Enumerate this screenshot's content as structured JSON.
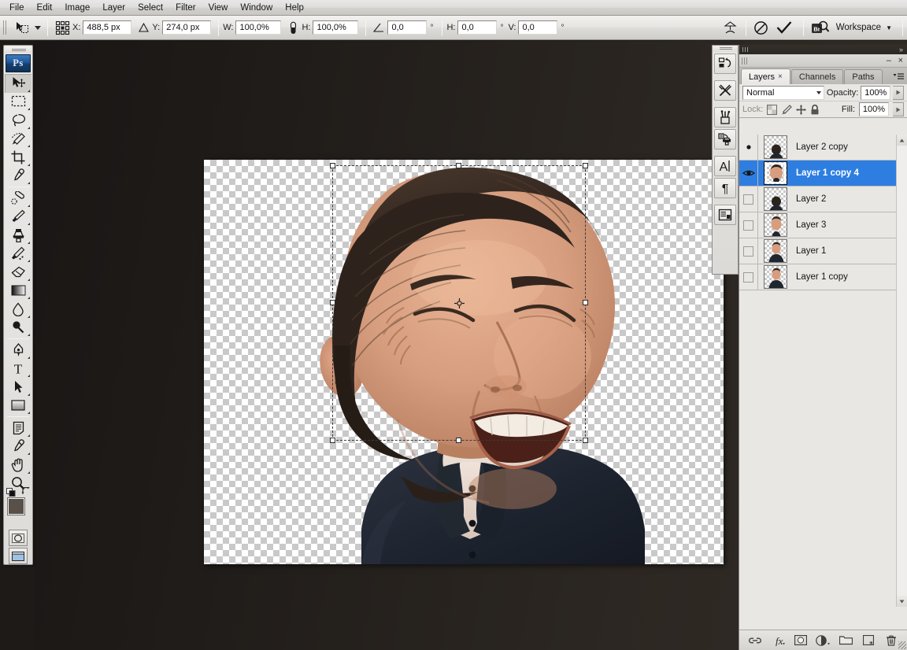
{
  "app": {
    "title": "Adobe Photoshop",
    "logo_text": "Ps"
  },
  "menubar": {
    "items": [
      {
        "label": "File"
      },
      {
        "label": "Edit"
      },
      {
        "label": "Image"
      },
      {
        "label": "Layer"
      },
      {
        "label": "Select"
      },
      {
        "label": "Filter"
      },
      {
        "label": "View"
      },
      {
        "label": "Window"
      },
      {
        "label": "Help"
      }
    ]
  },
  "options_bar": {
    "active_tool_icon": "move-tool-icon",
    "ref_point_icon": "reference-point-locator-icon",
    "x_label": "X:",
    "x_value": "488,5 px",
    "delta_icon": "delta-triangle-icon",
    "y_label": "Y:",
    "y_value": "274,0 px",
    "w_label": "W:",
    "w_value": "100,0%",
    "link_icon": "maintain-aspect-ratio-icon",
    "h_label": "H:",
    "h_value": "100,0%",
    "angle_icon": "rotate-angle-icon",
    "angle_value": "0,0",
    "angle_unit": "°",
    "skew_h_label": "H:",
    "skew_h_value": "0,0",
    "skew_h_unit": "°",
    "skew_v_label": "V:",
    "skew_v_value": "0,0",
    "skew_v_unit": "°",
    "warp_icon": "switch-to-warp-mode-icon",
    "cancel_icon": "cancel-transform-icon",
    "commit_icon": "commit-transform-icon",
    "bridge_icon": "go-to-bridge-icon",
    "workspace_label": "Workspace",
    "workspace_caret": "▼"
  },
  "toolbox": {
    "tools": [
      {
        "name": "move-tool",
        "selected": true,
        "has_flyout": true
      },
      {
        "name": "rectangular-marquee-tool",
        "has_flyout": true
      },
      {
        "name": "lasso-tool",
        "has_flyout": true
      },
      {
        "name": "quick-selection-tool",
        "has_flyout": true
      },
      {
        "name": "crop-tool",
        "has_flyout": true
      },
      {
        "name": "eyedropper-tool",
        "has_flyout": true
      },
      {
        "name": "spot-healing-brush-tool",
        "has_flyout": true,
        "group_start": true
      },
      {
        "name": "brush-tool",
        "has_flyout": true
      },
      {
        "name": "clone-stamp-tool",
        "has_flyout": true
      },
      {
        "name": "history-brush-tool",
        "has_flyout": true
      },
      {
        "name": "eraser-tool",
        "has_flyout": true
      },
      {
        "name": "gradient-tool",
        "has_flyout": true
      },
      {
        "name": "blur-tool",
        "has_flyout": true
      },
      {
        "name": "dodge-tool",
        "has_flyout": true
      },
      {
        "name": "pen-tool",
        "has_flyout": true,
        "group_start": true
      },
      {
        "name": "horizontal-type-tool",
        "has_flyout": true
      },
      {
        "name": "path-selection-tool",
        "has_flyout": true
      },
      {
        "name": "rectangle-shape-tool",
        "has_flyout": true
      },
      {
        "name": "notes-tool",
        "has_flyout": true,
        "group_start": true
      },
      {
        "name": "color-sampler-tool",
        "has_flyout": true
      },
      {
        "name": "hand-tool",
        "has_flyout": true
      },
      {
        "name": "zoom-tool",
        "has_flyout": false
      }
    ],
    "foreground_color": "#595049",
    "background_color": "#000000",
    "default_colors_icon": "default-foreground-background-icon",
    "swap_colors_icon": "swap-foreground-background-icon",
    "quickmask_icon": "edit-in-quick-mask-mode-icon",
    "screenmode_icon": "change-screen-mode-icon"
  },
  "icon_dock": {
    "buttons": [
      {
        "name": "history-panel-icon"
      },
      {
        "name": "tool-presets-panel-icon"
      },
      {
        "name": "brushes-panel-icon"
      },
      {
        "name": "clone-source-panel-icon"
      },
      {
        "name": "character-panel-icon",
        "glyph": "A"
      },
      {
        "name": "paragraph-panel-icon",
        "glyph": "¶"
      },
      {
        "name": "layer-comps-panel-icon"
      }
    ]
  },
  "canvas": {
    "transparency": "checkerboard",
    "transform_active": true,
    "reference_point_icon": "transform-reference-point-icon",
    "handles": [
      "top-left",
      "top-center",
      "top-right",
      "middle-left",
      "middle-right",
      "bottom-left",
      "bottom-center",
      "bottom-right"
    ],
    "artwork_description": "caricature portrait with enlarged head on dark jacket, transparent background"
  },
  "layers_panel": {
    "grip_icon": "panel-grip-icon",
    "expand_icon": "»",
    "minimize_label": "–",
    "close_label": "×",
    "menu_icon": "panel-menu-icon",
    "tabs": [
      {
        "label": "Layers",
        "active": true,
        "closable": true
      },
      {
        "label": "Channels",
        "active": false,
        "closable": false
      },
      {
        "label": "Paths",
        "active": false,
        "closable": false
      }
    ],
    "blend_mode": "Normal",
    "opacity_label": "Opacity:",
    "opacity_value": "100%",
    "lock_label": "Lock:",
    "lock_icons": [
      {
        "name": "lock-transparent-pixels-icon"
      },
      {
        "name": "lock-image-pixels-icon"
      },
      {
        "name": "lock-position-icon"
      },
      {
        "name": "lock-all-icon"
      }
    ],
    "fill_label": "Fill:",
    "fill_value": "100%",
    "selection_color": "#2d7ee0",
    "layers": [
      {
        "name": "Layer 2 copy",
        "visible": true,
        "selected": false,
        "thumb": "body"
      },
      {
        "name": "Layer 1 copy 4",
        "visible": true,
        "selected": true,
        "thumb": "head"
      },
      {
        "name": "Layer 2",
        "visible": false,
        "selected": false,
        "thumb": "body"
      },
      {
        "name": "Layer 3",
        "visible": false,
        "selected": false,
        "thumb": "head"
      },
      {
        "name": "Layer 1",
        "visible": false,
        "selected": false,
        "thumb": "full"
      },
      {
        "name": "Layer 1 copy",
        "visible": false,
        "selected": false,
        "thumb": "full"
      }
    ],
    "bottom_buttons": [
      {
        "name": "link-layers-icon"
      },
      {
        "name": "add-layer-style-icon",
        "glyph": "fx"
      },
      {
        "name": "add-layer-mask-icon"
      },
      {
        "name": "new-adjustment-layer-icon"
      },
      {
        "name": "new-group-icon"
      },
      {
        "name": "new-layer-icon"
      },
      {
        "name": "delete-layer-icon"
      }
    ],
    "scroll_up_icon": "▲",
    "scroll_down_icon": "▼"
  }
}
